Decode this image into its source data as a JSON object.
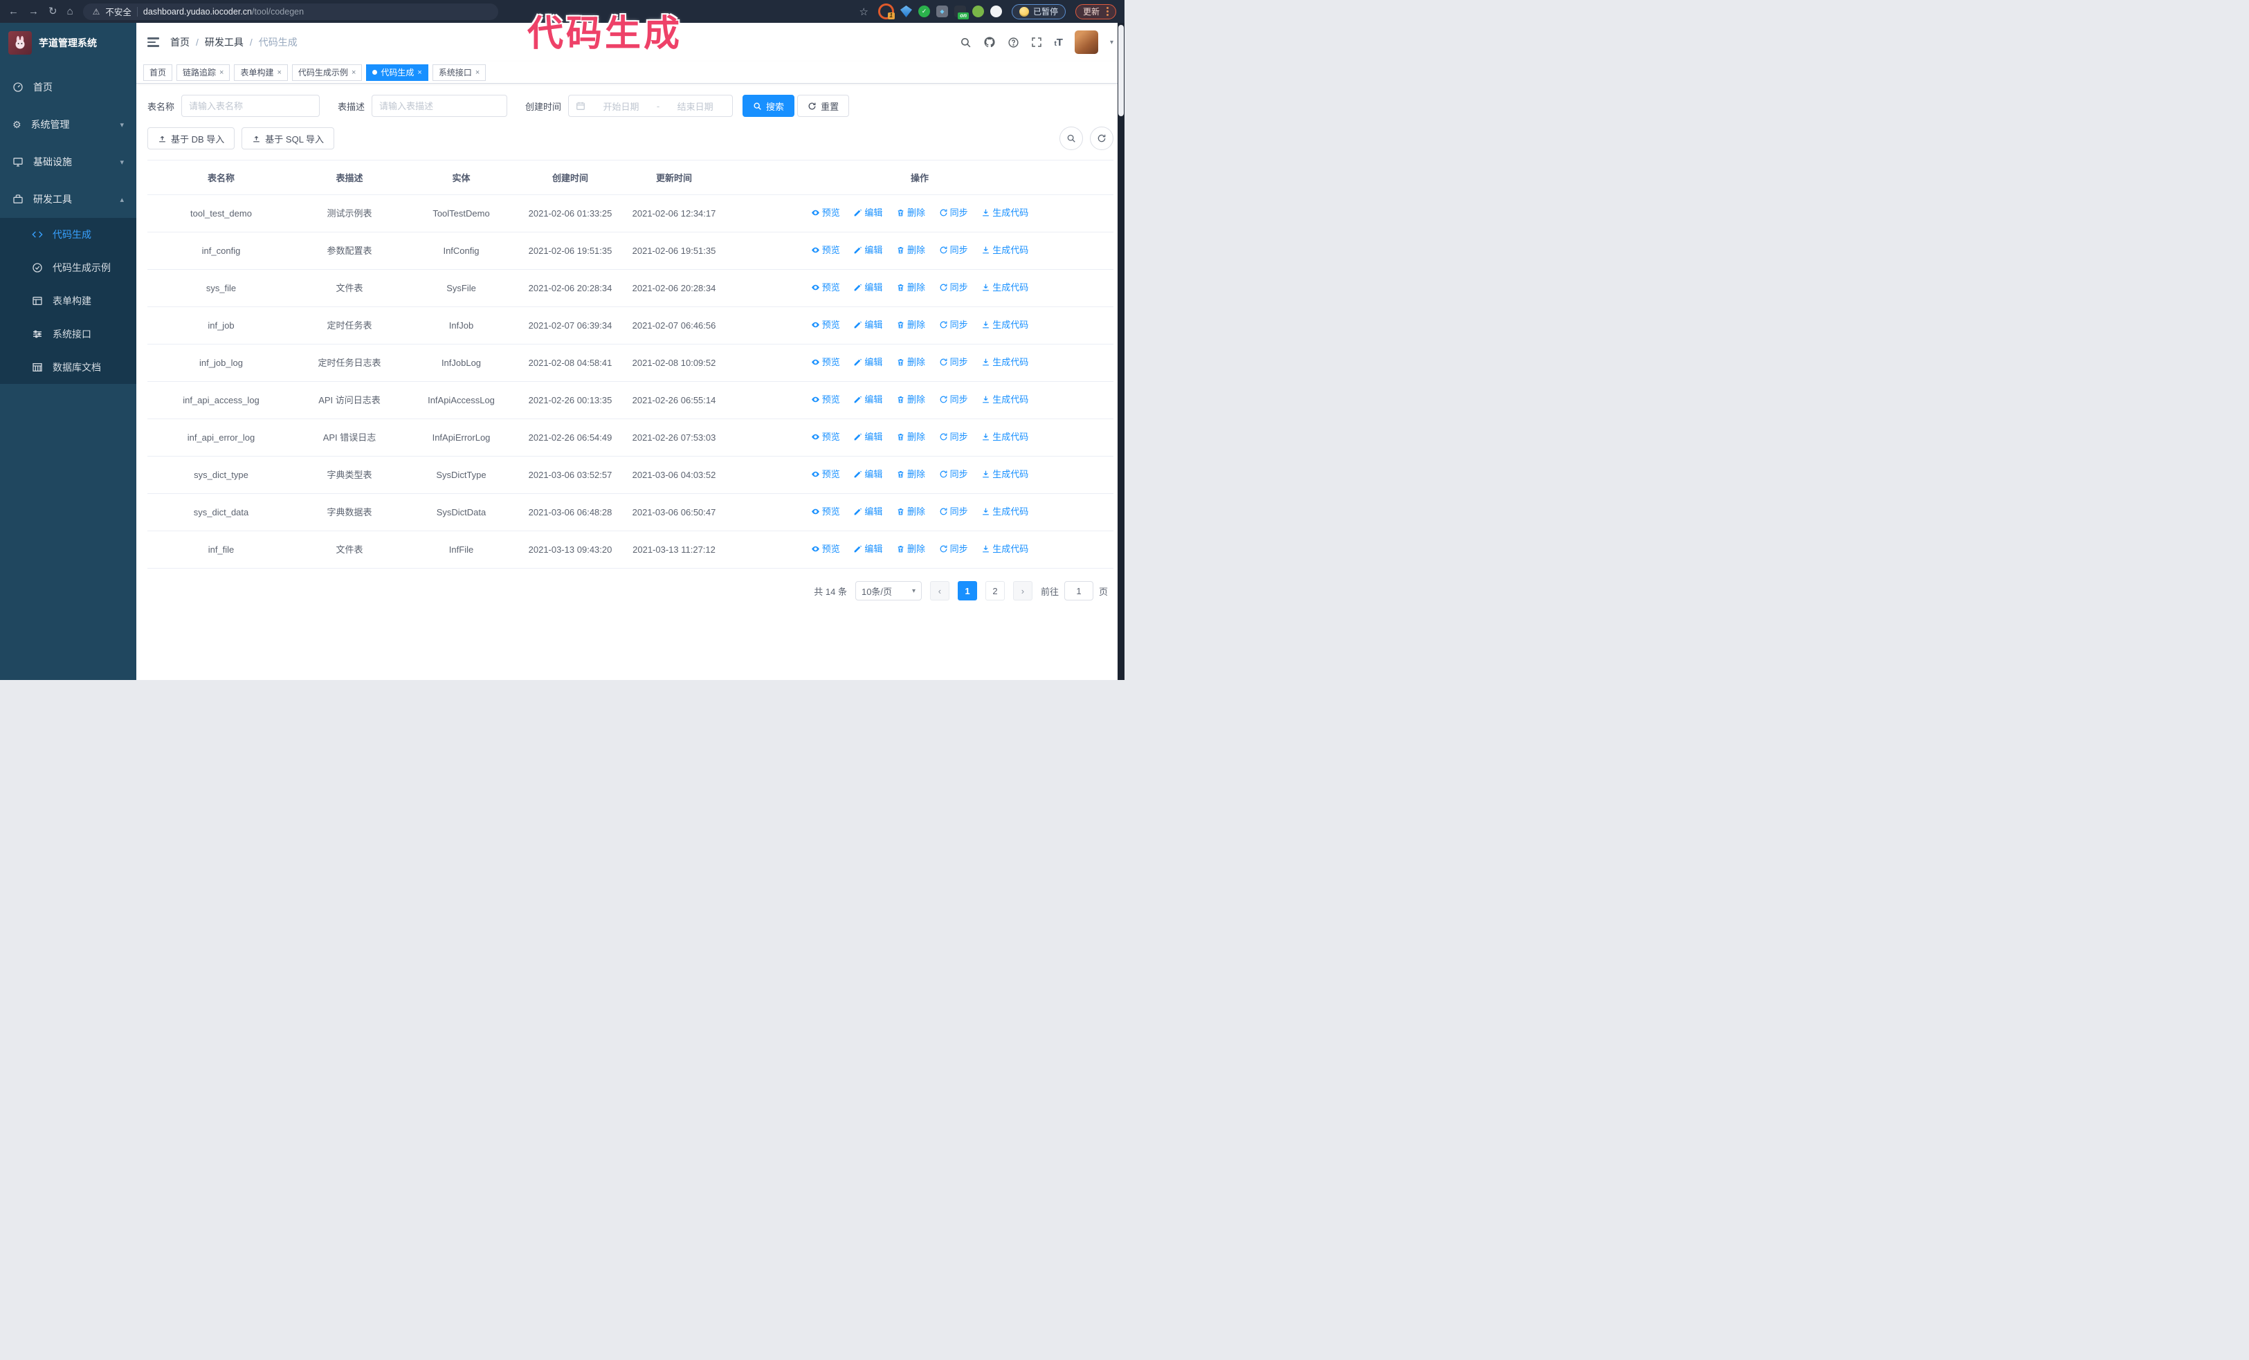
{
  "browser": {
    "security_warning": "不安全",
    "url_host": "dashboard.yudao.iocoder.cn",
    "url_path": "/tool/codegen",
    "paused_badge": "已暂停",
    "update_badge": "更新",
    "ext_badge_1": "1",
    "ext_badge_on": "on"
  },
  "watermark": "代码生成",
  "icons": {
    "back": "←",
    "forward": "→",
    "reload": "↻",
    "home": "⌂",
    "warning": "⚠",
    "star": "☆",
    "close": "×",
    "caret_down": "▾",
    "chevron_down": "▾",
    "chevron_up": "▴",
    "page_prev": "‹",
    "page_next": "›",
    "gear": "⚙",
    "font_size": "tT"
  },
  "sidebar": {
    "app_title": "芋道管理系统",
    "items": [
      {
        "label": "首页"
      },
      {
        "label": "系统管理"
      },
      {
        "label": "基础设施"
      },
      {
        "label": "研发工具"
      }
    ],
    "submenu": [
      {
        "label": "代码生成",
        "active": true
      },
      {
        "label": "代码生成示例"
      },
      {
        "label": "表单构建"
      },
      {
        "label": "系统接口"
      },
      {
        "label": "数据库文档"
      }
    ]
  },
  "header": {
    "breadcrumb": [
      "首页",
      "研发工具",
      "代码生成"
    ]
  },
  "tabs": [
    {
      "label": "首页"
    },
    {
      "label": "链路追踪"
    },
    {
      "label": "表单构建"
    },
    {
      "label": "代码生成示例"
    },
    {
      "label": "代码生成"
    },
    {
      "label": "系统接口"
    }
  ],
  "filters": {
    "table_name_label": "表名称",
    "table_name_placeholder": "请输入表名称",
    "table_desc_label": "表描述",
    "table_desc_placeholder": "请输入表描述",
    "create_time_label": "创建时间",
    "date_start_placeholder": "开始日期",
    "date_separator": "-",
    "date_end_placeholder": "结束日期",
    "search_label": "搜索",
    "reset_label": "重置"
  },
  "toolbar": {
    "import_db_label": "基于 DB 导入",
    "import_sql_label": "基于 SQL 导入"
  },
  "table": {
    "columns": [
      "表名称",
      "表描述",
      "实体",
      "创建时间",
      "更新时间",
      "操作"
    ],
    "row_actions": [
      "预览",
      "编辑",
      "删除",
      "同步",
      "生成代码"
    ],
    "rows": [
      {
        "name": "tool_test_demo",
        "desc": "测试示例表",
        "entity": "ToolTestDemo",
        "created": "2021-02-06 01:33:25",
        "updated": "2021-02-06 12:34:17"
      },
      {
        "name": "inf_config",
        "desc": "参数配置表",
        "entity": "InfConfig",
        "created": "2021-02-06 19:51:35",
        "updated": "2021-02-06 19:51:35"
      },
      {
        "name": "sys_file",
        "desc": "文件表",
        "entity": "SysFile",
        "created": "2021-02-06 20:28:34",
        "updated": "2021-02-06 20:28:34"
      },
      {
        "name": "inf_job",
        "desc": "定时任务表",
        "entity": "InfJob",
        "created": "2021-02-07 06:39:34",
        "updated": "2021-02-07 06:46:56"
      },
      {
        "name": "inf_job_log",
        "desc": "定时任务日志表",
        "entity": "InfJobLog",
        "created": "2021-02-08 04:58:41",
        "updated": "2021-02-08 10:09:52"
      },
      {
        "name": "inf_api_access_log",
        "desc": "API 访问日志表",
        "entity": "InfApiAccessLog",
        "created": "2021-02-26 00:13:35",
        "updated": "2021-02-26 06:55:14"
      },
      {
        "name": "inf_api_error_log",
        "desc": "API 错误日志",
        "entity": "InfApiErrorLog",
        "created": "2021-02-26 06:54:49",
        "updated": "2021-02-26 07:53:03"
      },
      {
        "name": "sys_dict_type",
        "desc": "字典类型表",
        "entity": "SysDictType",
        "created": "2021-03-06 03:52:57",
        "updated": "2021-03-06 04:03:52"
      },
      {
        "name": "sys_dict_data",
        "desc": "字典数据表",
        "entity": "SysDictData",
        "created": "2021-03-06 06:48:28",
        "updated": "2021-03-06 06:50:47"
      },
      {
        "name": "inf_file",
        "desc": "文件表",
        "entity": "InfFile",
        "created": "2021-03-13 09:43:20",
        "updated": "2021-03-13 11:27:12"
      }
    ]
  },
  "pagination": {
    "total_label": "共 14 条",
    "page_size": "10条/页",
    "pages": [
      "1",
      "2"
    ],
    "active_page": "1",
    "goto_label": "前往",
    "goto_value": "1",
    "goto_suffix": "页"
  }
}
